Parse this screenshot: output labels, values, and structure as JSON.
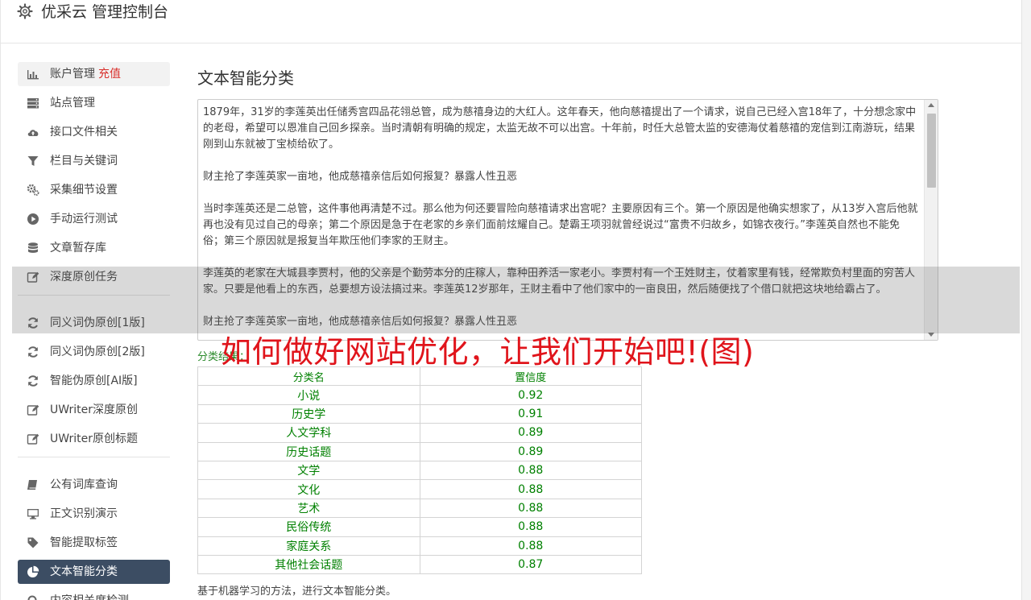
{
  "header": {
    "title": "优采云 管理控制台",
    "icon": "gear-icon"
  },
  "sidebar": {
    "groups": [
      [
        {
          "label": "账户管理",
          "badge": "充值",
          "icon": "bar-chart-icon",
          "state": "hover"
        },
        {
          "label": "站点管理",
          "icon": "server-icon"
        },
        {
          "label": "接口文件相关",
          "icon": "cloud-upload-icon"
        },
        {
          "label": "栏目与关键词",
          "icon": "filter-icon"
        },
        {
          "label": "采集细节设置",
          "icon": "gears-icon"
        },
        {
          "label": "手动运行测试",
          "icon": "play-circle-icon"
        },
        {
          "label": "文章暂存库",
          "icon": "database-icon"
        },
        {
          "label": "深度原创任务",
          "icon": "edit-icon"
        }
      ],
      [
        {
          "label": "同义词伪原创[1版]",
          "icon": "refresh-icon"
        },
        {
          "label": "同义词伪原创[2版]",
          "icon": "refresh-icon"
        },
        {
          "label": "智能伪原创[AI版]",
          "icon": "refresh-icon"
        },
        {
          "label": "UWriter深度原创",
          "icon": "edit-icon"
        },
        {
          "label": "UWriter原创标题",
          "icon": "edit-icon"
        }
      ],
      [
        {
          "label": "公有词库查询",
          "icon": "book-icon"
        },
        {
          "label": "正文识别演示",
          "icon": "monitor-icon"
        },
        {
          "label": "智能提取标签",
          "icon": "tag-icon"
        },
        {
          "label": "文本智能分类",
          "icon": "pie-chart-icon",
          "state": "active"
        },
        {
          "label": "内容相关度检测",
          "icon": "search-icon"
        }
      ]
    ]
  },
  "main": {
    "title": "文本智能分类",
    "article": [
      "1879年，31岁的李莲英出任储秀宫四品花翎总管，成为慈禧身边的大红人。这年春天，他向慈禧提出了一个请求，说自己已经入宫18年了，十分想念家中的老母，希望可以恩准自己回乡探亲。当时清朝有明确的规定，太监无故不可以出宫。十年前，时任大总管太监的安德海仗着慈禧的宠信到江南游玩，结果刚到山东就被丁宝桢给砍了。",
      "财主抢了李莲英家一亩地，他成慈禧亲信后如何报复？暴露人性丑恶",
      "当时李莲英还是二总管，这件事他再清楚不过。那么他为何还要冒险向慈禧请求出宫呢？主要原因有三个。第一个原因是他确实想家了，从13岁入宫后他就再也没有见过自己的母亲；第二个原因是急于在老家的乡亲们面前炫耀自己。楚霸王项羽就曾经说过“富贵不归故乡，如锦衣夜行。”李莲英自然也不能免俗；第三个原因就是报复当年欺压他们李家的王财主。",
      "李莲英的老家在大城县李贾村，他的父亲是个勤劳本分的庄稼人，靠种田养活一家老小。李贾村有一个王姓财主，仗着家里有钱，经常欺负村里面的穷苦人家。只要是他看上的东西，总要想方设法搞过来。李莲英12岁那年，王财主看中了他们家中的一亩良田，然后随便找了个借口就把这块地给霸占了。",
      "财主抢了李莲英家一亩地，他成慈禧亲信后如何报复？暴露人性丑恶"
    ],
    "watermark": "如何做好网站优化，让我们开始吧!(图)",
    "result_label": "分类结果：",
    "table": {
      "headers": [
        "分类名",
        "置信度"
      ],
      "rows": [
        [
          "小说",
          "0.92"
        ],
        [
          "历史学",
          "0.91"
        ],
        [
          "人文学科",
          "0.89"
        ],
        [
          "历史话题",
          "0.89"
        ],
        [
          "文学",
          "0.88"
        ],
        [
          "文化",
          "0.88"
        ],
        [
          "艺术",
          "0.88"
        ],
        [
          "民俗传统",
          "0.88"
        ],
        [
          "家庭关系",
          "0.88"
        ],
        [
          "其他社会话题",
          "0.87"
        ]
      ]
    },
    "footer": "基于机器学习的方法，进行文本智能分类。"
  },
  "colors": {
    "active_bg": "#3c4d63",
    "badge": "#d9302c",
    "result_green": "#008000",
    "watermark_red": "#e0141b"
  }
}
